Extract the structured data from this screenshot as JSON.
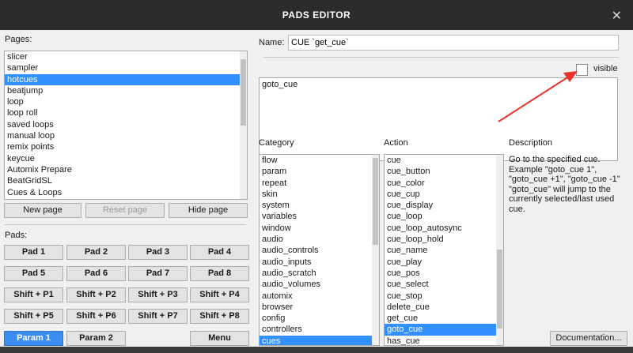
{
  "window": {
    "title": "PADS EDITOR",
    "close_glyph": "✕"
  },
  "pages": {
    "label": "Pages:",
    "items": [
      "slicer",
      "sampler",
      "hotcues",
      "beatjump",
      "loop",
      "loop roll",
      "saved loops",
      "manual loop",
      "remix points",
      "keycue",
      "Automix Prepare",
      "BeatGridSL",
      "Cues & Loops"
    ],
    "selected": "hotcues",
    "buttons": {
      "new_page": "New page",
      "reset_page": "Reset page",
      "hide_page": "Hide page"
    }
  },
  "pads": {
    "label": "Pads:",
    "buttons": [
      "Pad 1",
      "Pad 2",
      "Pad 3",
      "Pad 4",
      "Pad 5",
      "Pad 6",
      "Pad 7",
      "Pad 8",
      "Shift + P1",
      "Shift + P2",
      "Shift + P3",
      "Shift + P4",
      "Shift + P5",
      "Shift + P6",
      "Shift + P7",
      "Shift + P8"
    ],
    "param1": "Param 1",
    "param2": "Param 2",
    "menu": "Menu"
  },
  "name": {
    "label": "Name:",
    "value": "CUE `get_cue`"
  },
  "visible": {
    "label": "visible",
    "checked": false
  },
  "script": {
    "text": "goto_cue"
  },
  "category": {
    "label": "Category",
    "items": [
      "flow",
      "param",
      "repeat",
      "skin",
      "system",
      "variables",
      "window",
      "audio",
      "audio_controls",
      "audio_inputs",
      "audio_scratch",
      "audio_volumes",
      "automix",
      "browser",
      "config",
      "controllers",
      "cues"
    ],
    "selected": "cues"
  },
  "action": {
    "label": "Action",
    "items": [
      "cue",
      "cue_button",
      "cue_color",
      "cue_cup",
      "cue_display",
      "cue_loop",
      "cue_loop_autosync",
      "cue_loop_hold",
      "cue_name",
      "cue_play",
      "cue_pos",
      "cue_select",
      "cue_stop",
      "delete_cue",
      "get_cue",
      "goto_cue",
      "has_cue"
    ],
    "selected": "goto_cue"
  },
  "description": {
    "label": "Description",
    "lines": [
      "Go to the specified cue.",
      "Example \"goto_cue 1\",",
      "\"goto_cue +1\", \"goto_cue -1\"",
      "\"goto_cue\" will jump to the",
      "currently selected/last used",
      "cue."
    ]
  },
  "documentation_button": "Documentation...",
  "annotation": {
    "arrow_color": "#e8332a"
  }
}
